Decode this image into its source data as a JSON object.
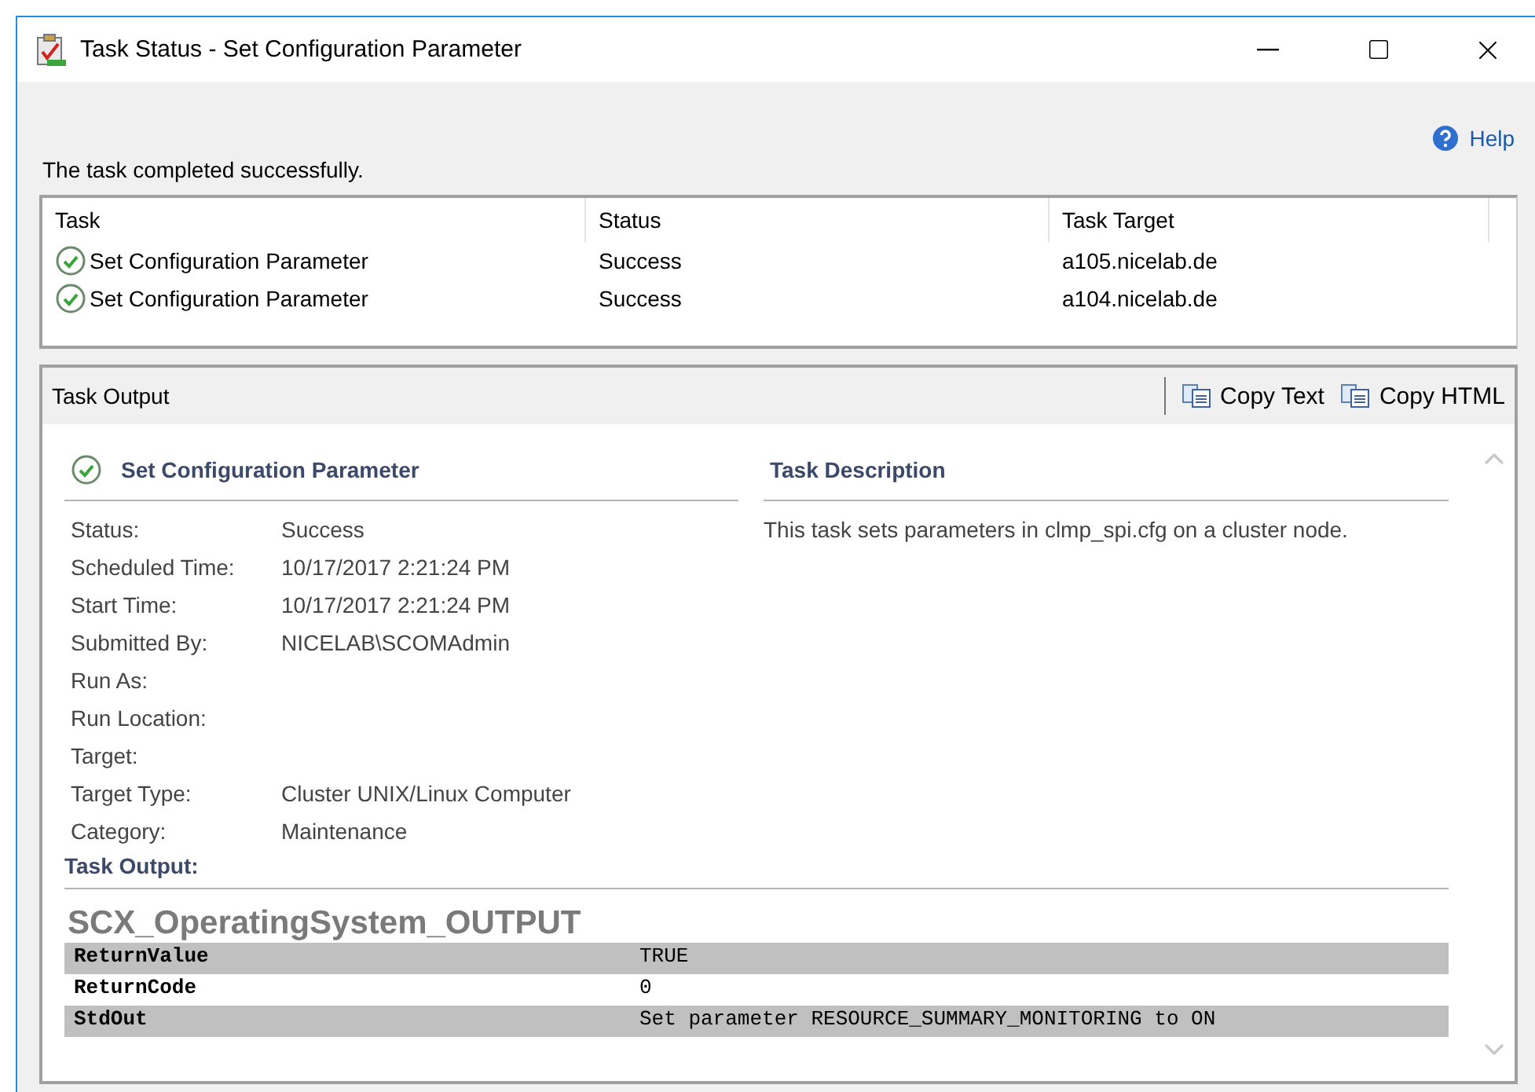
{
  "window": {
    "title": "Task Status - Set Configuration Parameter"
  },
  "help_link": "Help",
  "message": "The task completed successfully.",
  "task_list": {
    "columns": [
      "Task",
      "Status",
      "Task Target"
    ],
    "rows": [
      {
        "task": "Set Configuration Parameter",
        "status": "Success",
        "target": "a105.nicelab.de"
      },
      {
        "task": "Set Configuration Parameter",
        "status": "Success",
        "target": "a104.nicelab.de"
      }
    ]
  },
  "output": {
    "title": "Task Output",
    "actions": [
      "Copy Text",
      "Copy HTML"
    ],
    "task_name": "Set Configuration Parameter",
    "description_heading": "Task Description",
    "description": "This task sets parameters in clmp_spi.cfg on a cluster node.",
    "fields": [
      {
        "label": "Status:",
        "value": "Success"
      },
      {
        "label": "Scheduled Time:",
        "value": "10/17/2017 2:21:24 PM"
      },
      {
        "label": "Start Time:",
        "value": "10/17/2017 2:21:24 PM"
      },
      {
        "label": "Submitted By:",
        "value": "NICELAB\\SCOMAdmin"
      },
      {
        "label": "Run As:"
      },
      {
        "label": "Run Location:"
      },
      {
        "label": "Target:"
      },
      {
        "label": "Target Type:",
        "value": "Cluster UNIX/Linux Computer"
      },
      {
        "label": "Category:",
        "value": "Maintenance"
      }
    ],
    "output_label": "Task Output:",
    "output_heading": "SCX_OperatingSystem_OUTPUT",
    "output_rows": [
      {
        "name": "ReturnValue",
        "value": "TRUE"
      },
      {
        "name": "ReturnCode",
        "value": "0"
      },
      {
        "name": "StdOut",
        "value": "Set parameter RESOURCE_SUMMARY_MONITORING to ON"
      }
    ]
  }
}
